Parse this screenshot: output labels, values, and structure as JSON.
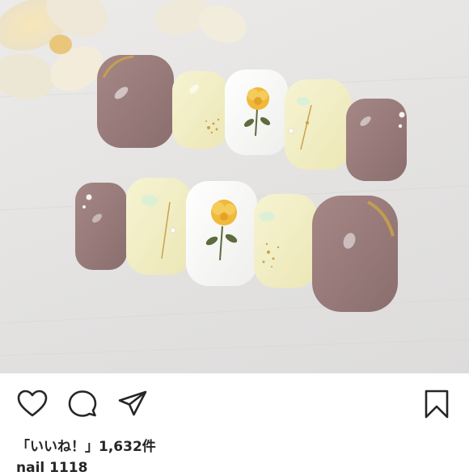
{
  "post": {
    "image_alt": "press-on nails with yellow flower design",
    "likes_text": "「いいね！」1,632件",
    "caption_preview": "nail 1118"
  },
  "actions": {
    "like_icon": "heart-icon",
    "comment_icon": "comment-icon",
    "share_icon": "share-icon",
    "save_icon": "bookmark-icon"
  },
  "colors": {
    "mauve": "#9a7b7a",
    "cream": "#f1edc4",
    "white_nail": "#f7f7f5",
    "flower": "#f0b93a",
    "leaf": "#5d6b3d",
    "gold": "#c9a24a"
  }
}
